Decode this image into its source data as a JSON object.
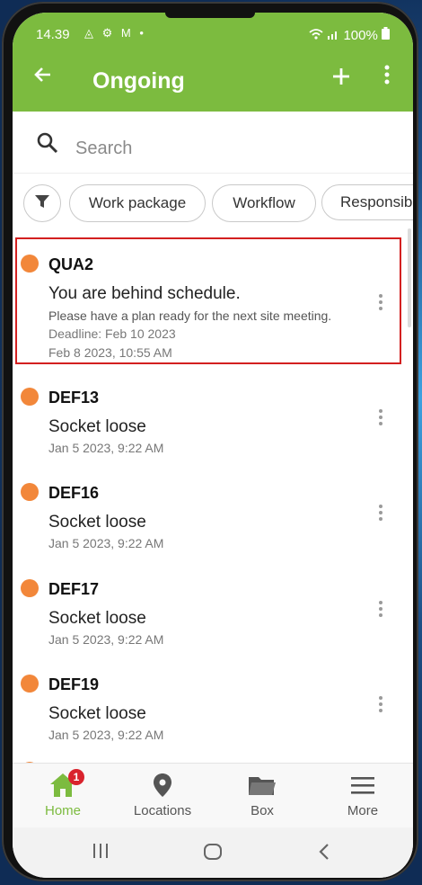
{
  "status": {
    "time": "14.39",
    "icons": "◬ ⚙ M •",
    "right": "100%"
  },
  "appbar": {
    "title": "Ongoing"
  },
  "search": {
    "placeholder": "Search"
  },
  "filters": [
    "Work package",
    "Workflow",
    "Responsibl"
  ],
  "items": [
    {
      "code": "QUA2",
      "subject": "You are behind schedule.",
      "description": "Please have a plan ready for the next site meeting.",
      "deadline": "Deadline: Feb 10 2023",
      "timestamp": "Feb 8 2023, 10:55 AM"
    },
    {
      "code": "DEF13",
      "subject": "Socket loose",
      "timestamp": "Jan 5 2023, 9:22 AM"
    },
    {
      "code": "DEF16",
      "subject": "Socket loose",
      "timestamp": "Jan 5 2023, 9:22 AM"
    },
    {
      "code": "DEF17",
      "subject": "Socket loose",
      "timestamp": "Jan 5 2023, 9:22 AM"
    },
    {
      "code": "DEF19",
      "subject": "Socket loose",
      "timestamp": "Jan 5 2023, 9:22 AM"
    }
  ],
  "nav": {
    "home": "Home",
    "home_badge": "1",
    "locations": "Locations",
    "box": "Box",
    "more": "More"
  },
  "colors": {
    "brand": "#7cbb3f",
    "status_dot": "#f2873a",
    "highlight": "#d32020"
  }
}
